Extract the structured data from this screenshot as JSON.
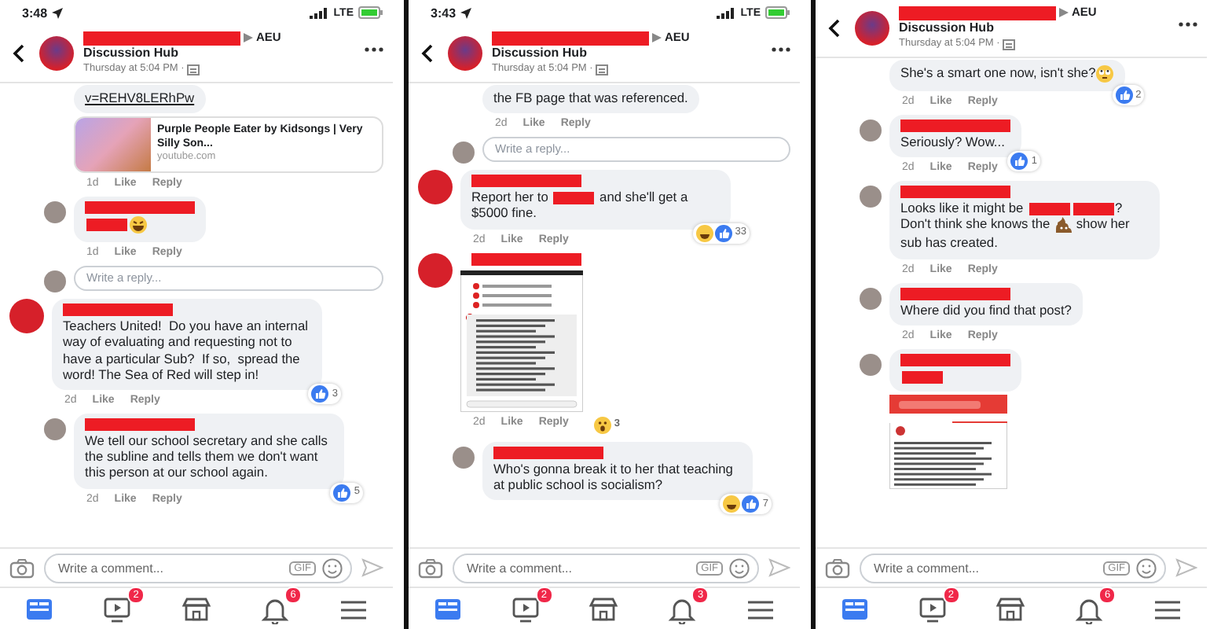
{
  "panels": [
    {
      "status_bar": {
        "time": "3:48",
        "network": "LTE"
      },
      "header": {
        "group": "AEU",
        "title": "Discussion Hub",
        "timestamp": "Thursday at 5:04 PM ·"
      },
      "comments": [
        {
          "kind": "reply",
          "continued": true,
          "segments": [
            {
              "kind": "link",
              "text": "v=REHV8LERhPw"
            }
          ],
          "preview": {
            "title": "Purple People Eater by Kidsongs | Very Silly Son...",
            "source": "youtube.com"
          },
          "meta": {
            "time": "1d",
            "like": "Like",
            "reply": "Reply"
          }
        },
        {
          "kind": "reply",
          "continued": false,
          "segments": [
            {
              "kind": "redaction"
            },
            {
              "kind": "laugh-emoji"
            }
          ],
          "meta": {
            "time": "1d",
            "like": "Like",
            "reply": "Reply"
          }
        },
        {
          "kind": "reply-field",
          "placeholder": "Write a reply..."
        },
        {
          "kind": "comment",
          "continued": false,
          "segments": [
            {
              "kind": "text",
              "text": "Teachers United!  Do you have an internal way of evaluating and requesting not to have a particular Sub?  If so,  spread the word! The Sea of Red will step in!"
            }
          ],
          "meta": {
            "time": "2d",
            "like": "Like",
            "reply": "Reply"
          },
          "reactions": {
            "icons": [
              {
                "kind": "like"
              }
            ],
            "count": "3"
          }
        },
        {
          "kind": "reply",
          "continued": false,
          "segments": [
            {
              "kind": "text",
              "text": "We tell our school secretary and she calls the subline and tells them we don't want this person at our school again."
            }
          ],
          "meta": {
            "time": "2d",
            "like": "Like",
            "reply": "Reply"
          },
          "reactions": {
            "icons": [
              {
                "kind": "like"
              }
            ],
            "count": "5"
          }
        }
      ],
      "composer": {
        "placeholder": "Write a comment...",
        "gif": "GIF"
      },
      "tabs": [
        {
          "kind": "feed",
          "selected": true
        },
        {
          "kind": "video",
          "selected": false,
          "badge": "2"
        },
        {
          "kind": "marketplace",
          "selected": false
        },
        {
          "kind": "bell",
          "selected": false,
          "badge": "6"
        },
        {
          "kind": "menu",
          "selected": false
        }
      ]
    },
    {
      "status_bar": {
        "time": "3:43",
        "network": "LTE"
      },
      "header": {
        "group": "AEU",
        "title": "Discussion Hub",
        "timestamp": "Thursday at 5:04 PM ·"
      },
      "comments": [
        {
          "kind": "reply",
          "continued": true,
          "segments": [
            {
              "kind": "text",
              "text": "the FB page that was referenced."
            }
          ],
          "meta": {
            "time": "2d",
            "like": "Like",
            "reply": "Reply"
          }
        },
        {
          "kind": "reply-field",
          "placeholder": "Write a reply..."
        },
        {
          "kind": "comment",
          "continued": false,
          "segments": [
            {
              "kind": "text",
              "text": "Report her to "
            },
            {
              "kind": "redaction"
            },
            {
              "kind": "text",
              "text": " and she'll get a $5000 fine."
            }
          ],
          "meta": {
            "time": "2d",
            "like": "Like",
            "reply": "Reply"
          },
          "reactions": {
            "icons": [
              {
                "kind": "haha"
              },
              {
                "kind": "like"
              }
            ],
            "count": "33"
          }
        },
        {
          "kind": "comment",
          "continued": false,
          "attachment": {
            "kind": "post-screenshot"
          },
          "meta": {
            "time": "2d",
            "like": "Like",
            "reply": "Reply"
          },
          "reactions": {
            "icons": [
              {
                "kind": "wow"
              }
            ],
            "count": "3"
          }
        },
        {
          "kind": "reply",
          "continued": false,
          "segments": [
            {
              "kind": "text",
              "text": "Who's gonna break it to her that teaching at public school is socialism?"
            }
          ],
          "reactions": {
            "icons": [
              {
                "kind": "haha"
              },
              {
                "kind": "like"
              }
            ],
            "count": "7"
          }
        }
      ],
      "composer": {
        "placeholder": "Write a comment...",
        "gif": "GIF"
      },
      "tabs": [
        {
          "kind": "feed",
          "selected": true
        },
        {
          "kind": "video",
          "selected": false,
          "badge": "2"
        },
        {
          "kind": "marketplace",
          "selected": false
        },
        {
          "kind": "bell",
          "selected": false,
          "badge": "3"
        },
        {
          "kind": "menu",
          "selected": false
        }
      ]
    },
    {
      "header": {
        "group": "AEU",
        "title": "Discussion Hub",
        "timestamp": "Thursday at 5:04 PM ·"
      },
      "comments": [
        {
          "kind": "reply",
          "continued": true,
          "segments": [
            {
              "kind": "text",
              "text": "She's a smart one now, isn't she?"
            },
            {
              "kind": "eyeroll-emoji"
            }
          ],
          "meta": {
            "time": "2d",
            "like": "Like",
            "reply": "Reply"
          },
          "reactions": {
            "icons": [
              {
                "kind": "like"
              }
            ],
            "count": "2"
          }
        },
        {
          "kind": "reply",
          "continued": false,
          "segments": [
            {
              "kind": "text",
              "text": "Seriously? Wow..."
            }
          ],
          "meta": {
            "time": "2d",
            "like": "Like",
            "reply": "Reply"
          },
          "reactions": {
            "icons": [
              {
                "kind": "like"
              }
            ],
            "count": "1"
          }
        },
        {
          "kind": "reply",
          "continued": false,
          "segments": [
            {
              "kind": "text",
              "text": "Looks like it might be "
            },
            {
              "kind": "redaction"
            },
            {
              "kind": "redaction"
            },
            {
              "kind": "text",
              "text": "? Don't think she knows the "
            },
            {
              "kind": "poop-emoji"
            },
            {
              "kind": "text",
              "text": " show her sub has created."
            }
          ],
          "meta": {
            "time": "2d",
            "like": "Like",
            "reply": "Reply"
          }
        },
        {
          "kind": "reply",
          "continued": false,
          "segments": [
            {
              "kind": "text",
              "text": "Where did you find that post?"
            }
          ],
          "meta": {
            "time": "2d",
            "like": "Like",
            "reply": "Reply"
          }
        },
        {
          "kind": "reply",
          "continued": false,
          "segments": [
            {
              "kind": "redaction"
            }
          ],
          "attachment": {
            "kind": "app-screenshot"
          }
        }
      ],
      "composer": {
        "placeholder": "Write a comment...",
        "gif": "GIF"
      },
      "tabs": [
        {
          "kind": "feed",
          "selected": true
        },
        {
          "kind": "video",
          "selected": false,
          "badge": "2"
        },
        {
          "kind": "marketplace",
          "selected": false
        },
        {
          "kind": "bell",
          "selected": false,
          "badge": "6"
        },
        {
          "kind": "menu",
          "selected": false
        }
      ]
    }
  ]
}
